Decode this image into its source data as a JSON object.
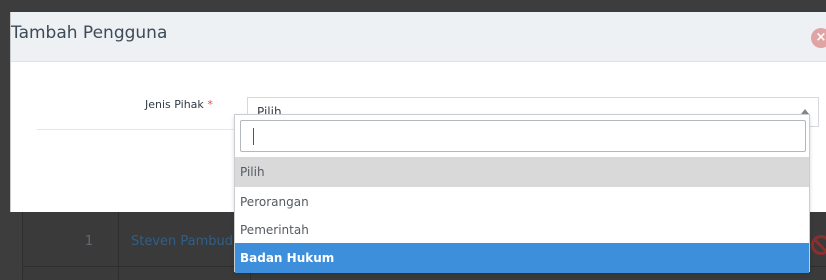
{
  "background": {
    "row_number": "1",
    "row_name": "Steven Pambudi"
  },
  "modal": {
    "title": "Tambah Pengguna",
    "close_icon_glyph": "×",
    "field_label": "Jenis Pihak",
    "required_mark": "*",
    "select_value": "Pilih"
  },
  "dropdown": {
    "search_value": "",
    "options": [
      {
        "label": "Pilih",
        "state": "selected"
      },
      {
        "label": "Perorangan",
        "state": "normal"
      },
      {
        "label": "Pemerintah",
        "state": "normal"
      },
      {
        "label": "Badan Hukum",
        "state": "highlighted"
      }
    ]
  },
  "colors": {
    "highlight": "#3d8edb",
    "selected": "#d9d9d9",
    "close_button": "#e0a4a4",
    "required": "#d9534f"
  }
}
